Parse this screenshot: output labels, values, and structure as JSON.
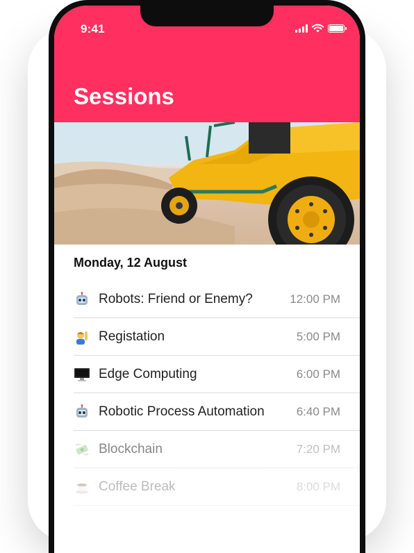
{
  "status_bar": {
    "time": "9:41"
  },
  "header": {
    "title": "Sessions",
    "bg_color": "#ff3060"
  },
  "hero": {
    "image": "yellow dune buggy on desert sand dunes"
  },
  "date_heading": "Monday, 12 August",
  "sessions": [
    {
      "icon": "robot-icon",
      "name": "Robots: Friend or Enemy?",
      "time": "12:00 PM"
    },
    {
      "icon": "person-raising-hand-icon",
      "name": "Registation",
      "time": "5:00 PM"
    },
    {
      "icon": "desktop-computer-icon",
      "name": "Edge Computing",
      "time": "6:00 PM"
    },
    {
      "icon": "robot-icon",
      "name": "Robotic Process Automation",
      "time": "6:40 PM"
    },
    {
      "icon": "money-with-wings-icon",
      "name": "Blockchain",
      "time": "7:20 PM"
    },
    {
      "icon": "coffee-icon",
      "name": "Coffee Break",
      "time": "8:00 PM"
    }
  ]
}
